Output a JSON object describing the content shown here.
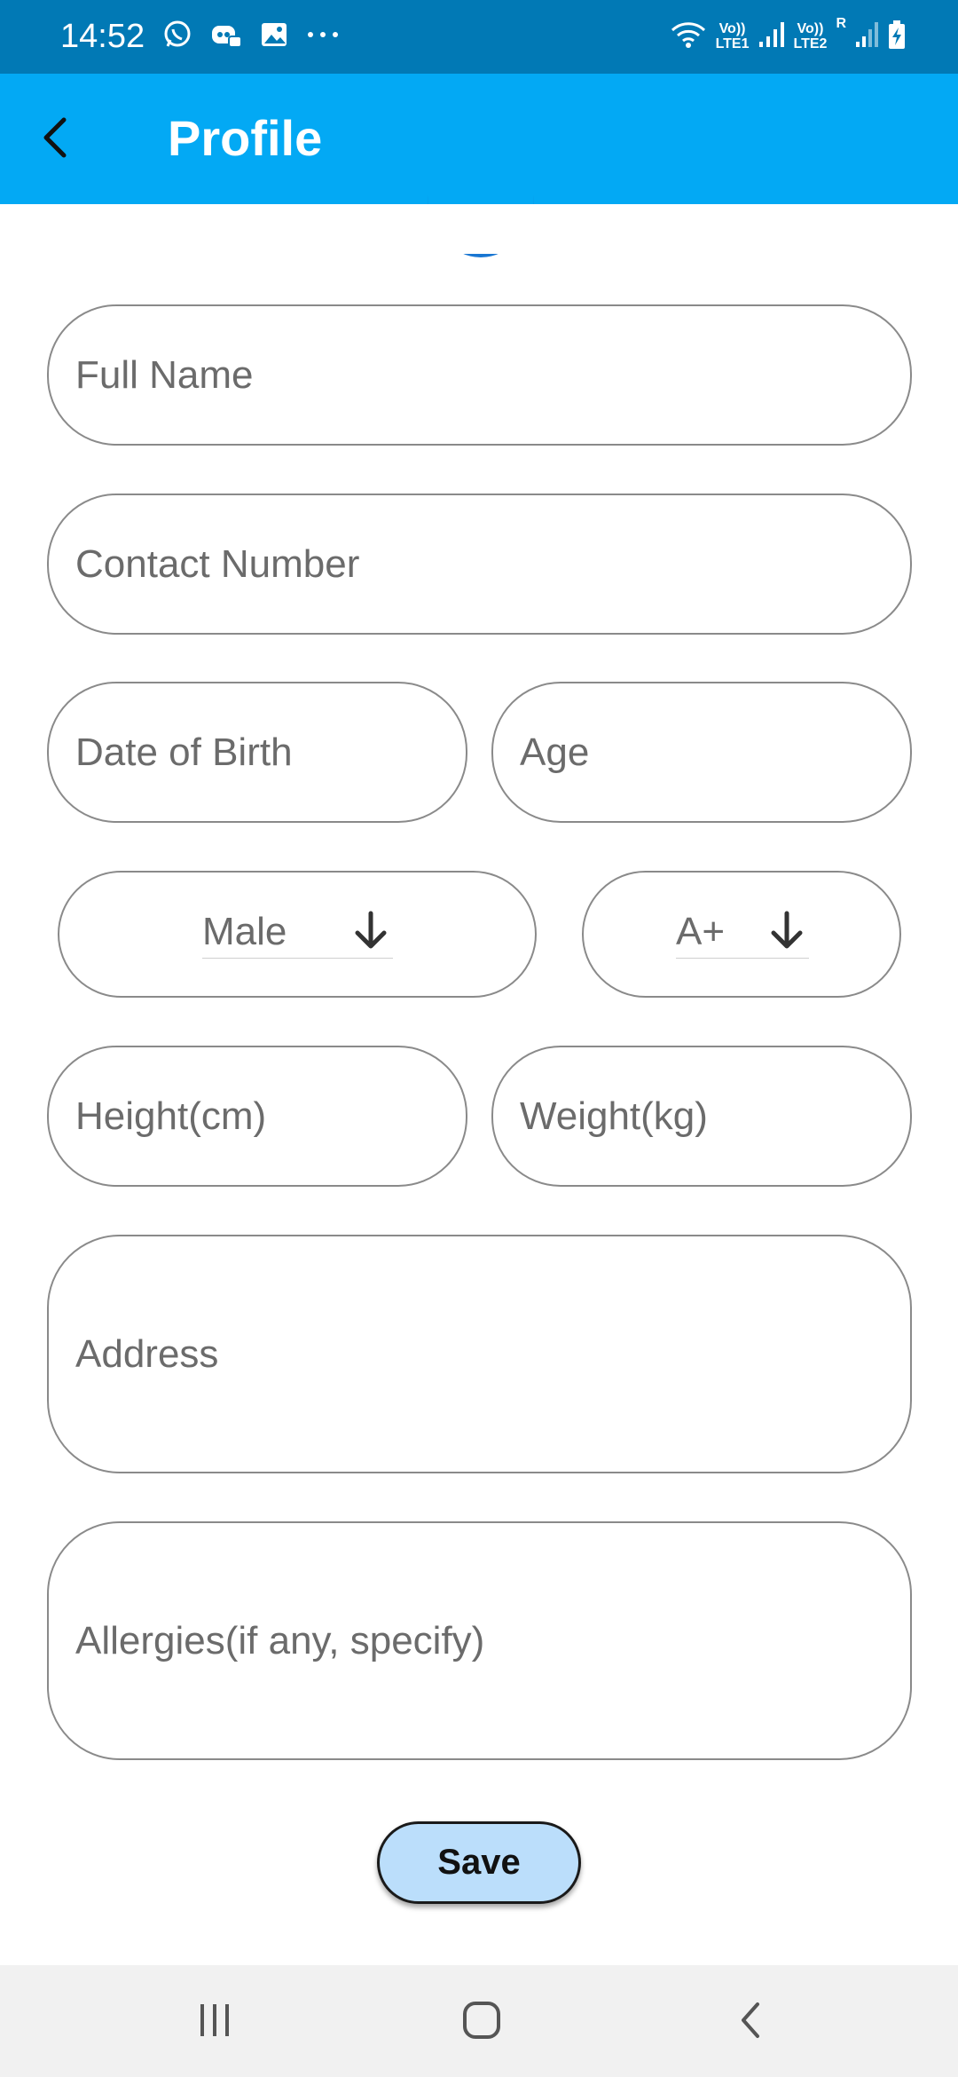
{
  "status_bar": {
    "time": "14:52",
    "icons_left": [
      "whatsapp-icon",
      "discord-icon",
      "gallery-icon",
      "more-dots-icon"
    ],
    "sim1": {
      "top": "Vo))",
      "bottom": "LTE1"
    },
    "sim2": {
      "top": "Vo))",
      "bottom": "LTE2"
    },
    "roaming": "R"
  },
  "app_bar": {
    "title": "Profile",
    "back_icon": "back-arrow-icon",
    "background": "#03A9F4"
  },
  "form": {
    "full_name": {
      "placeholder": "Full Name",
      "value": ""
    },
    "contact_number": {
      "placeholder": "Contact Number",
      "value": ""
    },
    "date_of_birth": {
      "placeholder": "Date of Birth",
      "value": ""
    },
    "age": {
      "placeholder": "Age",
      "value": ""
    },
    "gender": {
      "selected": "Male",
      "icon": "arrow-down-icon"
    },
    "blood_group": {
      "selected": "A+",
      "icon": "arrow-down-icon"
    },
    "height": {
      "placeholder": "Height(cm)",
      "value": ""
    },
    "weight": {
      "placeholder": "Weight(kg)",
      "value": ""
    },
    "address": {
      "placeholder": "Address",
      "value": ""
    },
    "allergies": {
      "placeholder": "Allergies(if any, specify)",
      "value": ""
    }
  },
  "save_button": {
    "label": "Save",
    "background": "#BBDEFB"
  },
  "nav_bar": {
    "buttons": [
      "recent-apps-icon",
      "home-icon",
      "back-icon"
    ]
  }
}
